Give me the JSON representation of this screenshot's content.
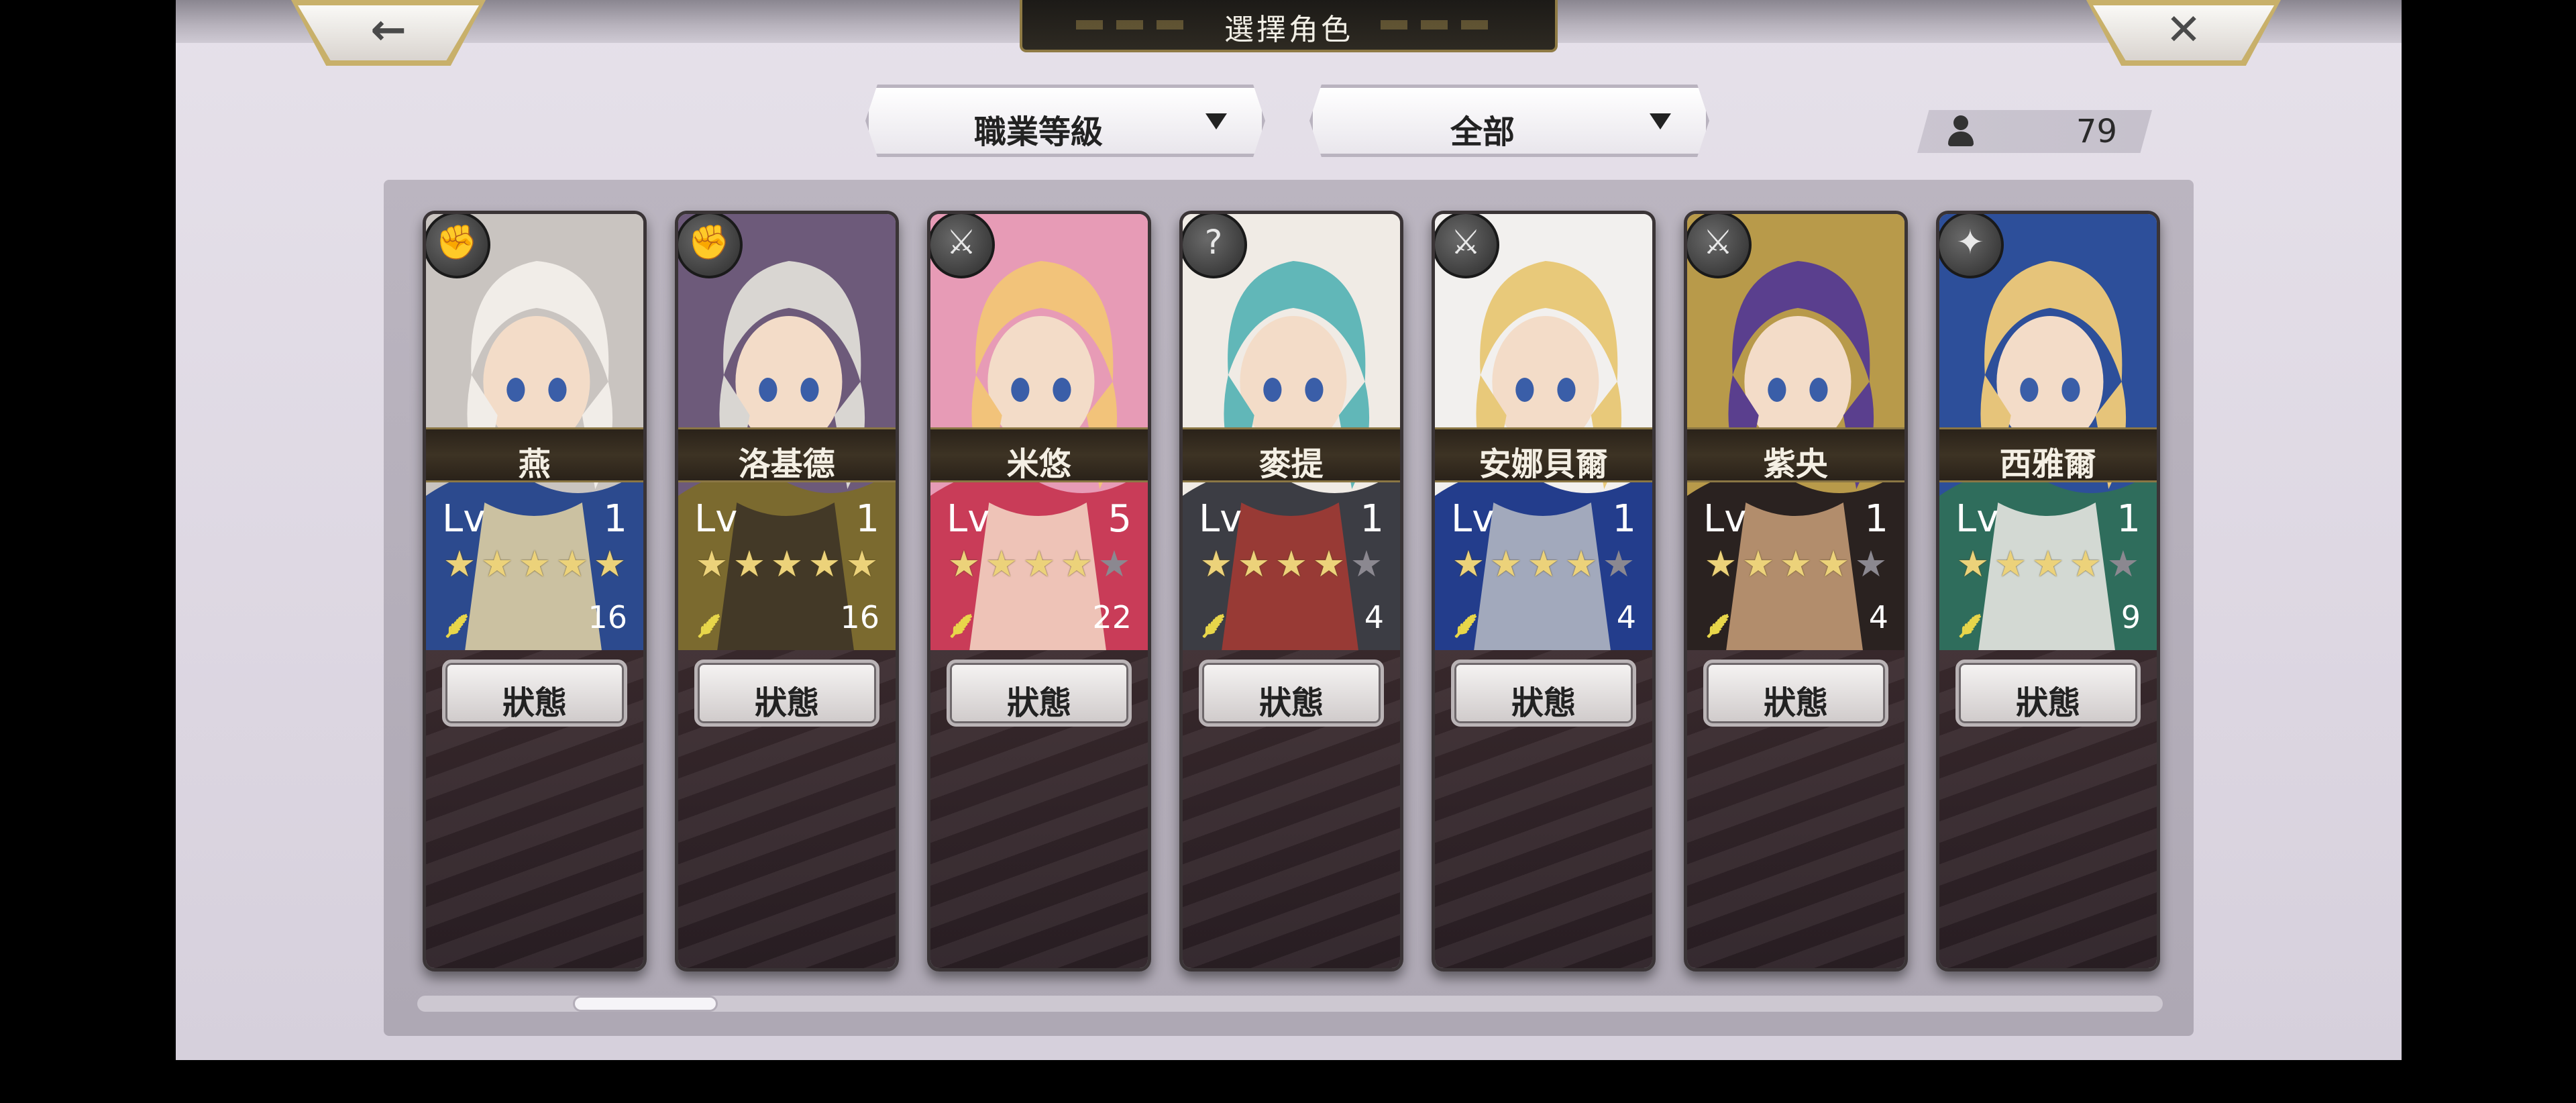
{
  "header": {
    "title": "選擇角色",
    "back_glyph": "←",
    "close_glyph": "✕"
  },
  "filters": {
    "sort_label": "職業等級",
    "category_label": "全部"
  },
  "roster": {
    "count": "79"
  },
  "icons": {
    "back": "back-arrow-icon",
    "close": "close-x-icon",
    "dropdown": "chevron-down-icon",
    "user": "user-icon",
    "rank": "wing-rank-icon"
  },
  "colors": {
    "star_on": "#ecd27a",
    "star_off": "#8b8890",
    "frame_gold": "#8f7b45"
  },
  "characters": [
    {
      "name": "燕",
      "lv_label": "Lv",
      "level": "1",
      "stars": 5,
      "rank": "16",
      "status_label": "狀態",
      "class_glyph": "✊",
      "palette": [
        "#f1ede8",
        "#c9c4c0",
        "#2c4a8e",
        "#e8d6a5"
      ]
    },
    {
      "name": "洛基德",
      "lv_label": "Lv",
      "level": "1",
      "stars": 5,
      "rank": "16",
      "status_label": "狀態",
      "class_glyph": "✊",
      "palette": [
        "#d9d6d2",
        "#6d5a7a",
        "#7b6a2f",
        "#3a3026"
      ]
    },
    {
      "name": "米悠",
      "lv_label": "Lv",
      "level": "5",
      "stars": 4,
      "rank": "22",
      "status_label": "狀態",
      "class_glyph": "⚔",
      "palette": [
        "#f2c37a",
        "#e79bb6",
        "#c93c58",
        "#f4dac8"
      ]
    },
    {
      "name": "麥提",
      "lv_label": "Lv",
      "level": "1",
      "stars": 4,
      "rank": "4",
      "status_label": "狀態",
      "class_glyph": "?",
      "palette": [
        "#61b7b8",
        "#f0ebe5",
        "#3c3d44",
        "#a83a32"
      ]
    },
    {
      "name": "安娜貝爾",
      "lv_label": "Lv",
      "level": "1",
      "stars": 4,
      "rank": "4",
      "status_label": "狀態",
      "class_glyph": "⚔",
      "palette": [
        "#e8c97a",
        "#f2f0ee",
        "#233d8c",
        "#b9bcc4"
      ]
    },
    {
      "name": "紫央",
      "lv_label": "Lv",
      "level": "1",
      "stars": 4,
      "rank": "4",
      "status_label": "狀態",
      "class_glyph": "⚔",
      "palette": [
        "#5a3f8e",
        "#b89a4a",
        "#2a2220",
        "#caa07a"
      ]
    },
    {
      "name": "西雅爾",
      "lv_label": "Lv",
      "level": "1",
      "stars": 4,
      "rank": "9",
      "status_label": "狀態",
      "class_glyph": "✦",
      "palette": [
        "#e6c47a",
        "#2d4f9a",
        "#2f6d5c",
        "#f0ece8"
      ]
    }
  ]
}
